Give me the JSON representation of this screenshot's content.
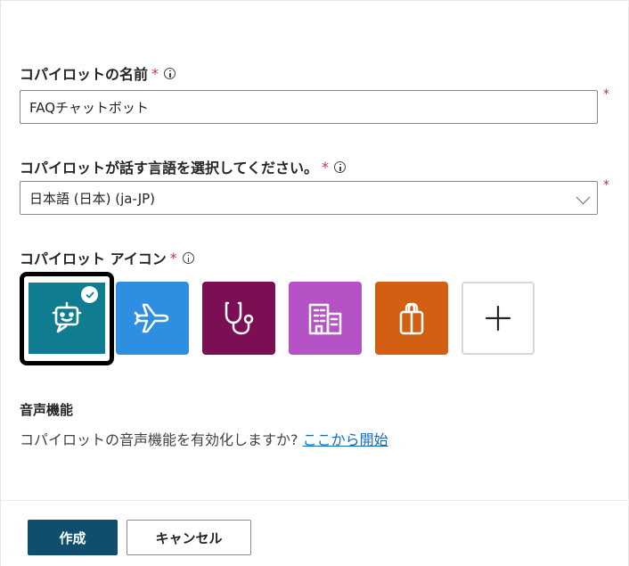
{
  "name_section": {
    "label": "コパイロットの名前",
    "required_mark": "*",
    "value": "FAQチャットボット",
    "side_mark": "*"
  },
  "language_section": {
    "label": "コパイロットが話す言語を選択してください。",
    "required_mark": "*",
    "selected": "日本語 (日本) (ja-JP)",
    "side_mark": "*"
  },
  "icon_section": {
    "label": "コパイロット アイコン",
    "required_mark": "*",
    "icons": [
      {
        "name": "robot-icon",
        "color": "#0f7c8f",
        "selected": true
      },
      {
        "name": "airplane-icon",
        "color": "#2e8fe2",
        "selected": false
      },
      {
        "name": "stethoscope-icon",
        "color": "#7c0f54",
        "selected": false
      },
      {
        "name": "building-icon",
        "color": "#b552c6",
        "selected": false
      },
      {
        "name": "shopping-bag-icon",
        "color": "#d35f13",
        "selected": false
      },
      {
        "name": "add-icon",
        "color": "#ffffff",
        "selected": false
      }
    ]
  },
  "voice_section": {
    "title": "音声機能",
    "description": "コパイロットの音声機能を有効化しますか? ",
    "link": "ここから開始"
  },
  "footer": {
    "create_label": "作成",
    "cancel_label": "キャンセル"
  }
}
